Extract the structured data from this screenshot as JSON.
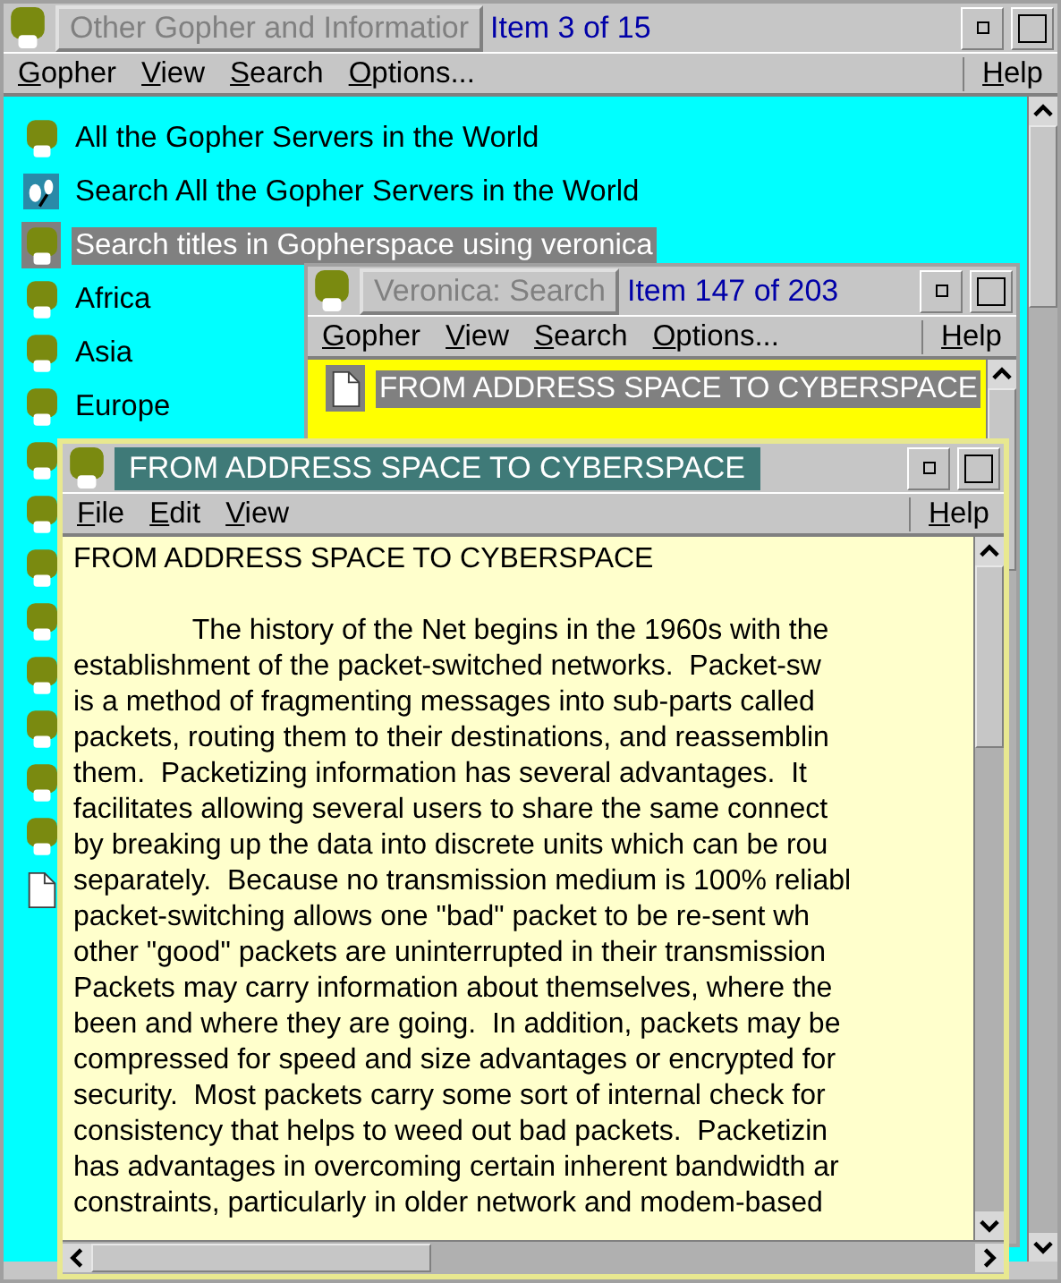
{
  "main": {
    "title": "Other Gopher and Informatior",
    "status": "Item 3 of 15",
    "active": false,
    "menu": [
      "Gopher",
      "View",
      "Search",
      "Options..."
    ],
    "help": "Help",
    "items": [
      {
        "kind": "gopher",
        "label": "All the Gopher Servers in the World",
        "selected": false
      },
      {
        "kind": "search",
        "label": "Search All the Gopher Servers in the World",
        "selected": false
      },
      {
        "kind": "gopher",
        "label": "Search titles in Gopherspace using veronica",
        "selected": true
      },
      {
        "kind": "gopher",
        "label": "Africa",
        "selected": false
      },
      {
        "kind": "gopher",
        "label": "Asia",
        "selected": false
      },
      {
        "kind": "gopher",
        "label": "Europe",
        "selected": false
      },
      {
        "kind": "gopher",
        "selected": false
      },
      {
        "kind": "gopher",
        "selected": false
      },
      {
        "kind": "gopher",
        "selected": false
      },
      {
        "kind": "gopher",
        "selected": false
      },
      {
        "kind": "gopher",
        "selected": false
      },
      {
        "kind": "gopher",
        "selected": false
      },
      {
        "kind": "gopher",
        "selected": false
      },
      {
        "kind": "gopher",
        "selected": false
      },
      {
        "kind": "document",
        "selected": false
      }
    ]
  },
  "veronica": {
    "title": "Veronica: Search",
    "status": "Item 147 of 203",
    "active": false,
    "menu": [
      "Gopher",
      "View",
      "Search",
      "Options..."
    ],
    "help": "Help",
    "items": [
      {
        "kind": "document",
        "label": "FROM ADDRESS SPACE TO CYBERSPACE",
        "selected": true
      }
    ]
  },
  "document": {
    "title": "FROM ADDRESS SPACE TO CYBERSPACE",
    "active": true,
    "menu": [
      "File",
      "Edit",
      "View"
    ],
    "help": "Help",
    "heading": "FROM ADDRESS SPACE TO CYBERSPACE",
    "lines": [
      "               The history of the Net begins in the 1960s with the",
      "establishment of the packet-switched networks.  Packet-sw",
      "is a method of fragmenting messages into sub-parts called",
      "packets, routing them to their destinations, and reassemblin",
      "them.  Packetizing information has several advantages.  It",
      "facilitates allowing several users to share the same connect",
      "by breaking up the data into discrete units which can be rou",
      "separately.  Because no transmission medium is 100% reliabl",
      "packet-switching allows one \"bad\" packet to be re-sent wh",
      "other \"good\" packets are uninterrupted in their transmission",
      "Packets may carry information about themselves, where the",
      "been and where they are going.  In addition, packets may be",
      "compressed for speed and size advantages or encrypted for",
      "security.  Most packets carry some sort of internal check for",
      "consistency that helps to weed out bad packets.  Packetizin",
      "has advantages in overcoming certain inherent bandwidth ar",
      "constraints, particularly in older network and modem-based"
    ]
  }
}
